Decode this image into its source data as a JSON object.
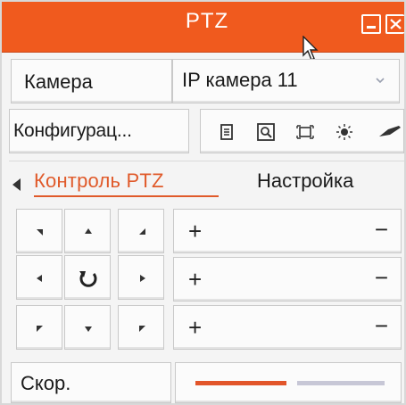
{
  "window": {
    "title": "PTZ"
  },
  "camera": {
    "label": "Камера",
    "selected": "IP камера 11"
  },
  "config": {
    "label": "Конфигурац..."
  },
  "tabs": [
    {
      "label": "Контроль PTZ",
      "active": true
    },
    {
      "label": "Настройка",
      "active": false
    }
  ],
  "zoom_rows": [
    {
      "plus": "+",
      "minus": "−"
    },
    {
      "plus": "+",
      "minus": "−"
    },
    {
      "plus": "+",
      "minus": "−"
    }
  ],
  "speed": {
    "label": "Скор.",
    "level": 0.48
  },
  "colors": {
    "accent": "#f05a1e",
    "active_tab": "#e05a2a",
    "slider_fill": "#e2552a",
    "slider_track": "#c7c7d6"
  },
  "icons": {
    "toolbar": [
      "document-icon",
      "zoom-box-icon",
      "focus-frame-icon",
      "light-icon",
      "wiper-icon"
    ],
    "grid": [
      "arrow-up-left-icon",
      "arrow-up-icon",
      "arrow-up-right-icon",
      "arrow-left-icon",
      "auto-rotate-icon",
      "arrow-right-icon",
      "arrow-down-left-icon",
      "arrow-down-icon",
      "arrow-down-right-icon"
    ]
  }
}
